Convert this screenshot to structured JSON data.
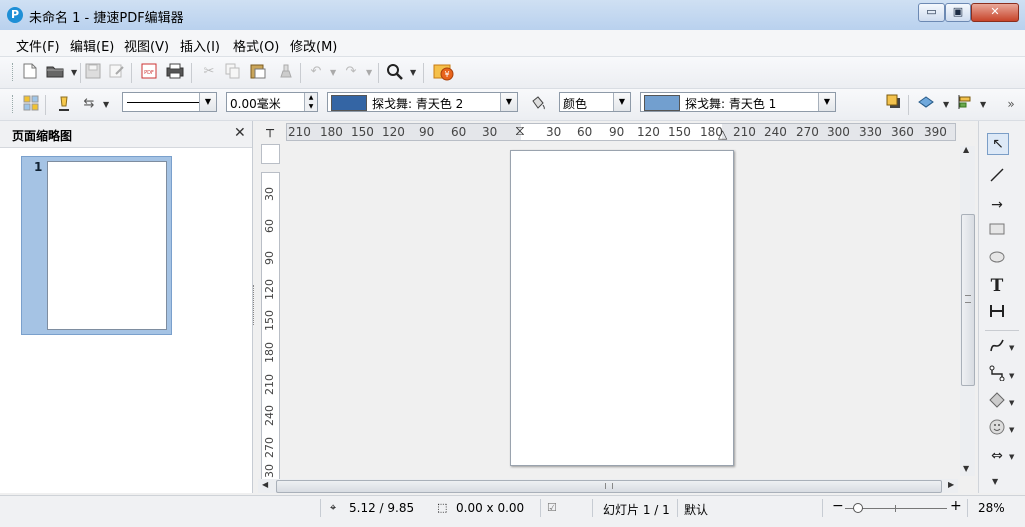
{
  "window": {
    "app_icon": "P",
    "title": "未命名 1 - 捷速PDF编辑器",
    "minimize_glyph": "▭",
    "maximize_glyph": "▣",
    "close_glyph": "✕"
  },
  "menu": [
    {
      "label": "文件(F)"
    },
    {
      "label": "编辑(E)"
    },
    {
      "label": "视图(V)"
    },
    {
      "label": "插入(I)"
    },
    {
      "label": "格式(O)"
    },
    {
      "label": "修改(M)"
    }
  ],
  "toolbar2": {
    "line_width_value": "0.00毫米",
    "line_color_label": "探戈舞: 青天色 2",
    "line_color_hex": "#3465a4",
    "area_style_label": "颜色",
    "fill_color_label": "探戈舞: 青天色 1",
    "fill_color_hex": "#729fcf",
    "more_glyph": "»"
  },
  "panel": {
    "title": "页面缩略图",
    "close_glyph": "✕",
    "thumbnail_number": "1"
  },
  "ruler": {
    "h_ticks_left": [
      "210",
      "180",
      "150",
      "120",
      "90",
      "60",
      "30"
    ],
    "h_ticks_right": [
      "30",
      "60",
      "90",
      "120",
      "150",
      "180",
      "210",
      "240",
      "270",
      "300",
      "330",
      "360",
      "390"
    ],
    "v_ticks": [
      "30",
      "60",
      "90",
      "120",
      "150",
      "180",
      "210",
      "240",
      "270",
      "30"
    ]
  },
  "status": {
    "position": "5.12 / 9.85",
    "size": "0.00 x 0.00",
    "slide": "幻灯片 1 / 1",
    "layout": "默认",
    "zoom": "28%",
    "zoom_minus": "−",
    "zoom_plus": "+"
  }
}
